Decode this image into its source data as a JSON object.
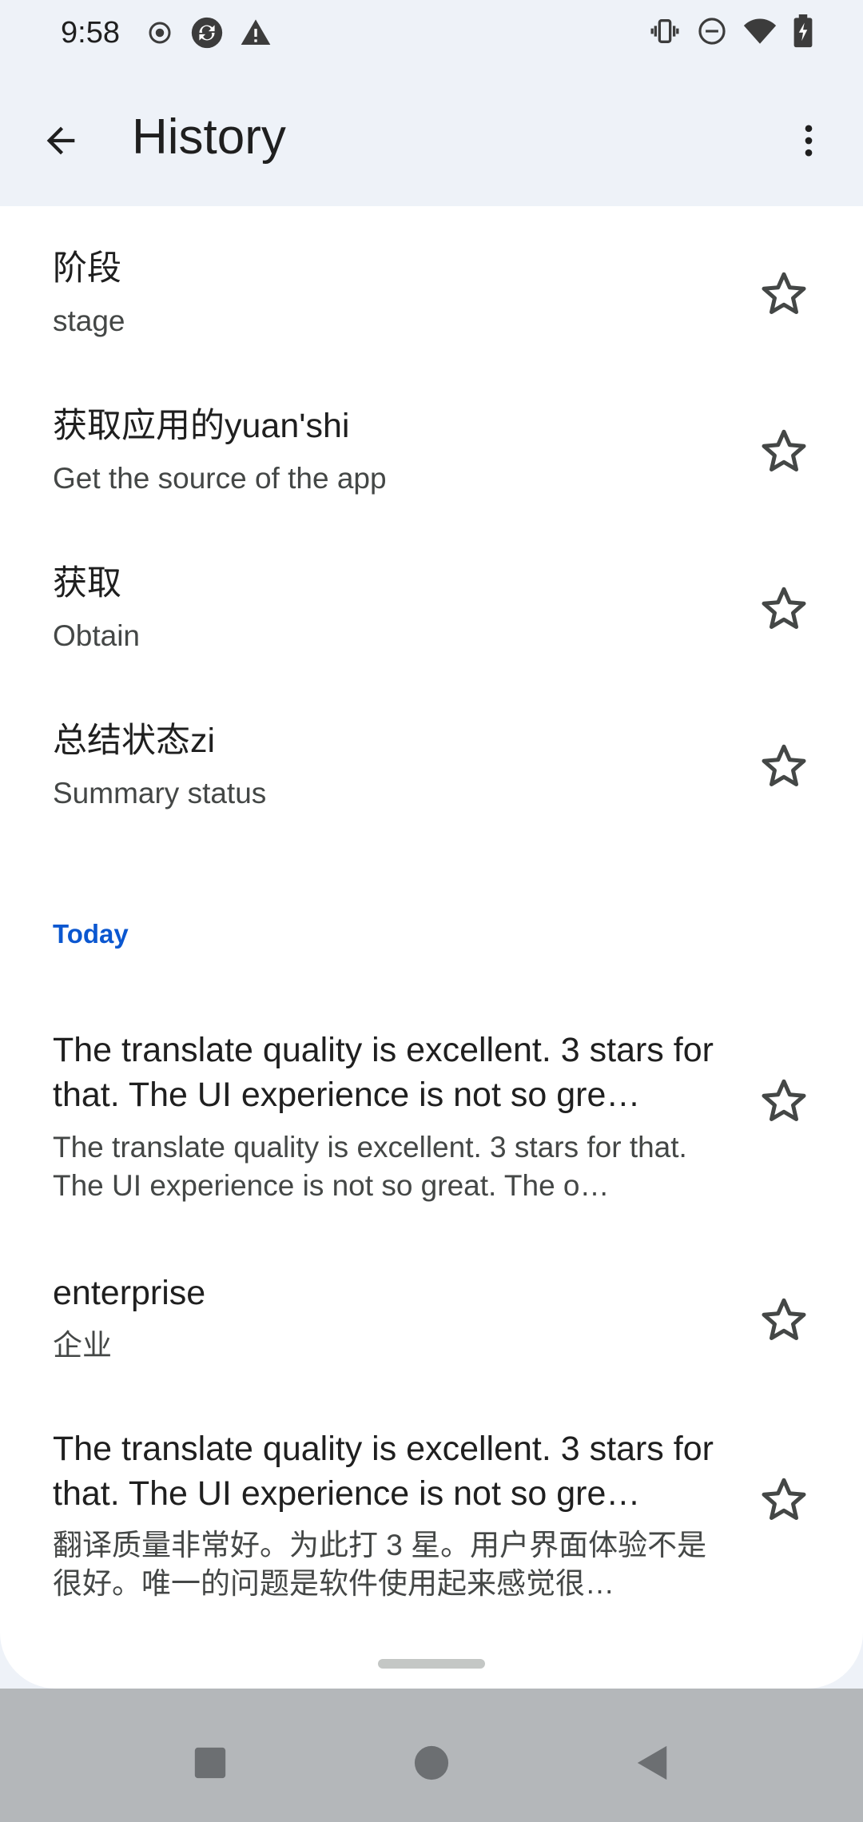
{
  "status_bar": {
    "time": "9:58",
    "left_icons": [
      "record-icon",
      "sync-icon",
      "warning-icon"
    ],
    "right_icons": [
      "vibrate-icon",
      "do-not-disturb-icon",
      "wifi-icon",
      "battery-charging-icon"
    ]
  },
  "app_bar": {
    "title": "History",
    "back_icon": "arrow-back-icon",
    "menu_icon": "more-vert-icon"
  },
  "history": {
    "items": [
      {
        "primary": "阶段",
        "secondary": "stage",
        "starred": false
      },
      {
        "primary": "获取应用的yuan'shi",
        "secondary": "Get the source of the app",
        "starred": false
      },
      {
        "primary": "获取",
        "secondary": "Obtain",
        "starred": false
      },
      {
        "primary": "总结状态zi",
        "secondary": "Summary status",
        "starred": false
      }
    ],
    "section_today": "Today",
    "today_items": [
      {
        "primary": "The translate quality is excellent. 3 stars for that. The UI experience is not so gre…",
        "secondary": "The translate quality is excellent. 3 stars for that. The UI experience is not so great. The o…",
        "starred": false
      },
      {
        "primary": "enterprise",
        "secondary": "企业",
        "starred": false
      },
      {
        "primary": "The translate quality is excellent. 3 stars for that. The UI experience is not so gre…",
        "secondary": "翻译质量非常好。为此打 3 星。用户界面体验不是很好。唯一的问题是软件使用起来感觉很…",
        "starred": false
      }
    ]
  },
  "nav_bar": {
    "buttons": [
      "recents-button",
      "home-button",
      "back-button"
    ]
  },
  "colors": {
    "background": "#eef2f8",
    "sheet": "#ffffff",
    "accent": "#0b57d0",
    "navbar": "#b4b7ba"
  }
}
